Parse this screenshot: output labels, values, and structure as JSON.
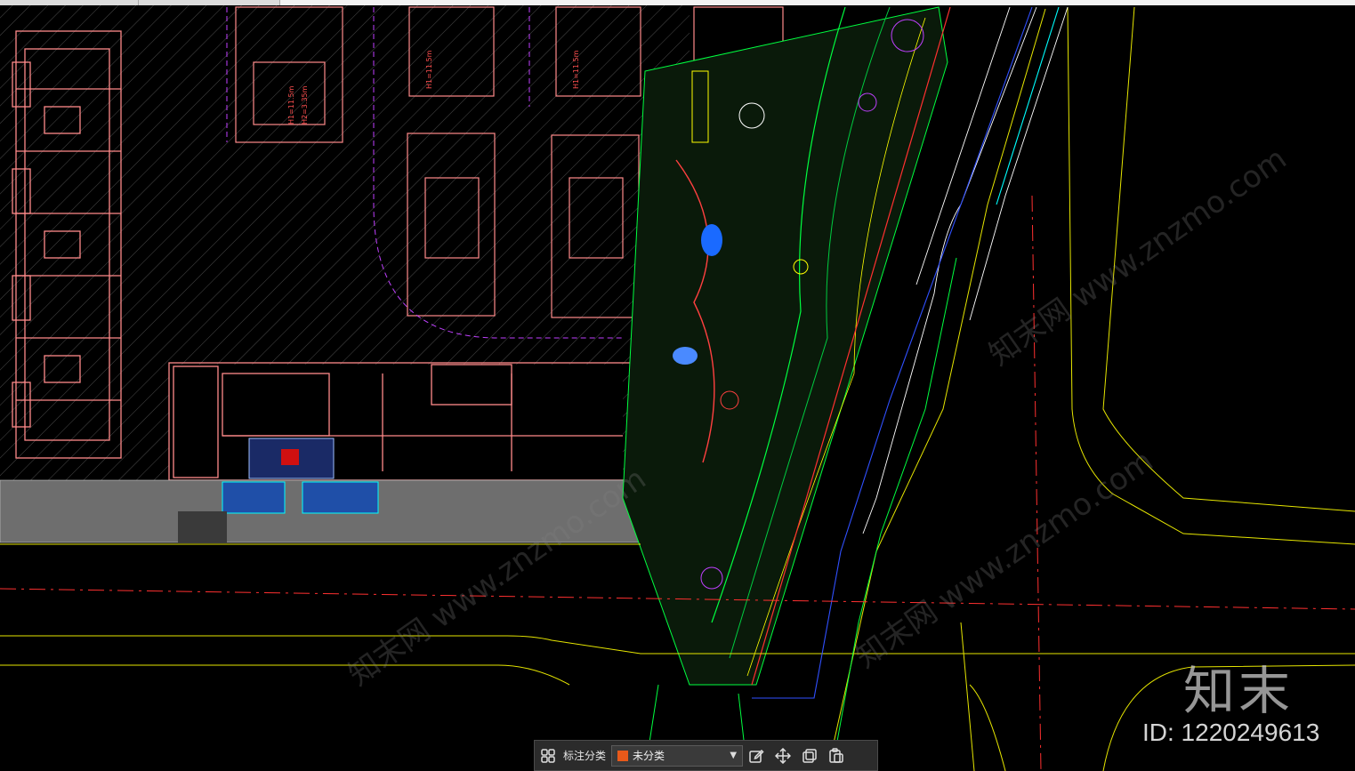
{
  "toolbar": {
    "label": "标注分类",
    "category_value": "未分类",
    "category_color": "#e8591a",
    "icons": [
      "grid-icon",
      "edit-icon",
      "move-icon",
      "copy-icon",
      "paste-icon"
    ]
  },
  "watermark": {
    "logo": "知末",
    "id_text": "ID: 1220249613",
    "diagonal_text": "知末网 www.znzmo.com"
  },
  "drawing": {
    "colors": {
      "building": "#ff8a8a",
      "hatch": "#5a5a5a",
      "road": "#e6e600",
      "axis": "#ff3030",
      "green": "#00ff40",
      "blue": "#3050ff",
      "cyan": "#00ffff",
      "magenta": "#c040ff",
      "white": "#ffffff"
    }
  }
}
